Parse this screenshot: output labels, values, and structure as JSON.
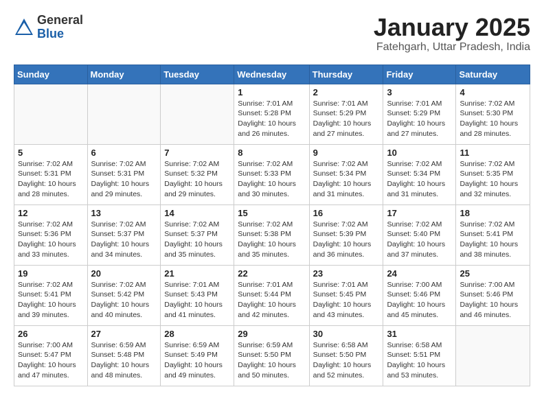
{
  "header": {
    "logo_general": "General",
    "logo_blue": "Blue",
    "month_title": "January 2025",
    "location": "Fatehgarh, Uttar Pradesh, India"
  },
  "weekdays": [
    "Sunday",
    "Monday",
    "Tuesday",
    "Wednesday",
    "Thursday",
    "Friday",
    "Saturday"
  ],
  "weeks": [
    [
      {
        "day": "",
        "info": ""
      },
      {
        "day": "",
        "info": ""
      },
      {
        "day": "",
        "info": ""
      },
      {
        "day": "1",
        "info": "Sunrise: 7:01 AM\nSunset: 5:28 PM\nDaylight: 10 hours\nand 26 minutes."
      },
      {
        "day": "2",
        "info": "Sunrise: 7:01 AM\nSunset: 5:29 PM\nDaylight: 10 hours\nand 27 minutes."
      },
      {
        "day": "3",
        "info": "Sunrise: 7:01 AM\nSunset: 5:29 PM\nDaylight: 10 hours\nand 27 minutes."
      },
      {
        "day": "4",
        "info": "Sunrise: 7:02 AM\nSunset: 5:30 PM\nDaylight: 10 hours\nand 28 minutes."
      }
    ],
    [
      {
        "day": "5",
        "info": "Sunrise: 7:02 AM\nSunset: 5:31 PM\nDaylight: 10 hours\nand 28 minutes."
      },
      {
        "day": "6",
        "info": "Sunrise: 7:02 AM\nSunset: 5:31 PM\nDaylight: 10 hours\nand 29 minutes."
      },
      {
        "day": "7",
        "info": "Sunrise: 7:02 AM\nSunset: 5:32 PM\nDaylight: 10 hours\nand 29 minutes."
      },
      {
        "day": "8",
        "info": "Sunrise: 7:02 AM\nSunset: 5:33 PM\nDaylight: 10 hours\nand 30 minutes."
      },
      {
        "day": "9",
        "info": "Sunrise: 7:02 AM\nSunset: 5:34 PM\nDaylight: 10 hours\nand 31 minutes."
      },
      {
        "day": "10",
        "info": "Sunrise: 7:02 AM\nSunset: 5:34 PM\nDaylight: 10 hours\nand 31 minutes."
      },
      {
        "day": "11",
        "info": "Sunrise: 7:02 AM\nSunset: 5:35 PM\nDaylight: 10 hours\nand 32 minutes."
      }
    ],
    [
      {
        "day": "12",
        "info": "Sunrise: 7:02 AM\nSunset: 5:36 PM\nDaylight: 10 hours\nand 33 minutes."
      },
      {
        "day": "13",
        "info": "Sunrise: 7:02 AM\nSunset: 5:37 PM\nDaylight: 10 hours\nand 34 minutes."
      },
      {
        "day": "14",
        "info": "Sunrise: 7:02 AM\nSunset: 5:37 PM\nDaylight: 10 hours\nand 35 minutes."
      },
      {
        "day": "15",
        "info": "Sunrise: 7:02 AM\nSunset: 5:38 PM\nDaylight: 10 hours\nand 35 minutes."
      },
      {
        "day": "16",
        "info": "Sunrise: 7:02 AM\nSunset: 5:39 PM\nDaylight: 10 hours\nand 36 minutes."
      },
      {
        "day": "17",
        "info": "Sunrise: 7:02 AM\nSunset: 5:40 PM\nDaylight: 10 hours\nand 37 minutes."
      },
      {
        "day": "18",
        "info": "Sunrise: 7:02 AM\nSunset: 5:41 PM\nDaylight: 10 hours\nand 38 minutes."
      }
    ],
    [
      {
        "day": "19",
        "info": "Sunrise: 7:02 AM\nSunset: 5:41 PM\nDaylight: 10 hours\nand 39 minutes."
      },
      {
        "day": "20",
        "info": "Sunrise: 7:02 AM\nSunset: 5:42 PM\nDaylight: 10 hours\nand 40 minutes."
      },
      {
        "day": "21",
        "info": "Sunrise: 7:01 AM\nSunset: 5:43 PM\nDaylight: 10 hours\nand 41 minutes."
      },
      {
        "day": "22",
        "info": "Sunrise: 7:01 AM\nSunset: 5:44 PM\nDaylight: 10 hours\nand 42 minutes."
      },
      {
        "day": "23",
        "info": "Sunrise: 7:01 AM\nSunset: 5:45 PM\nDaylight: 10 hours\nand 43 minutes."
      },
      {
        "day": "24",
        "info": "Sunrise: 7:00 AM\nSunset: 5:46 PM\nDaylight: 10 hours\nand 45 minutes."
      },
      {
        "day": "25",
        "info": "Sunrise: 7:00 AM\nSunset: 5:46 PM\nDaylight: 10 hours\nand 46 minutes."
      }
    ],
    [
      {
        "day": "26",
        "info": "Sunrise: 7:00 AM\nSunset: 5:47 PM\nDaylight: 10 hours\nand 47 minutes."
      },
      {
        "day": "27",
        "info": "Sunrise: 6:59 AM\nSunset: 5:48 PM\nDaylight: 10 hours\nand 48 minutes."
      },
      {
        "day": "28",
        "info": "Sunrise: 6:59 AM\nSunset: 5:49 PM\nDaylight: 10 hours\nand 49 minutes."
      },
      {
        "day": "29",
        "info": "Sunrise: 6:59 AM\nSunset: 5:50 PM\nDaylight: 10 hours\nand 50 minutes."
      },
      {
        "day": "30",
        "info": "Sunrise: 6:58 AM\nSunset: 5:50 PM\nDaylight: 10 hours\nand 52 minutes."
      },
      {
        "day": "31",
        "info": "Sunrise: 6:58 AM\nSunset: 5:51 PM\nDaylight: 10 hours\nand 53 minutes."
      },
      {
        "day": "",
        "info": ""
      }
    ]
  ]
}
